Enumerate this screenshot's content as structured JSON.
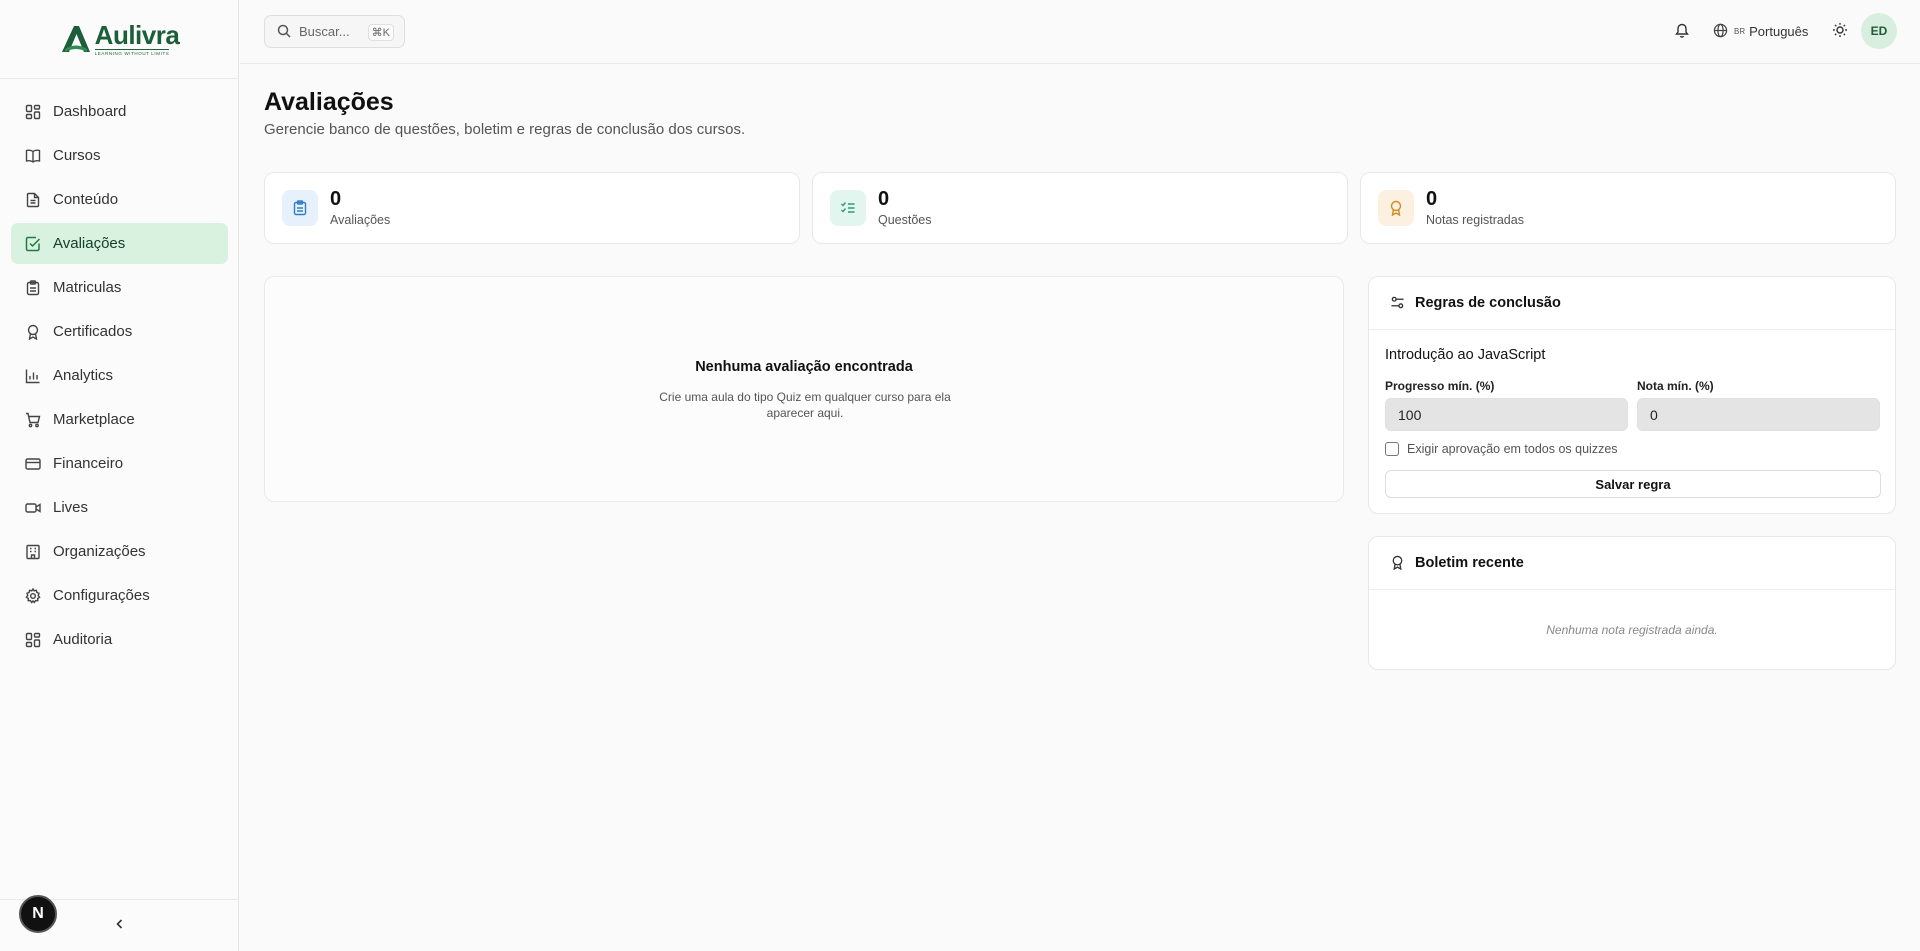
{
  "brand": {
    "name": "Aulivra",
    "tagline": "LEARNING WITHOUT LIMITS"
  },
  "sidebar": {
    "items": [
      {
        "label": "Dashboard",
        "icon": "dashboard-icon"
      },
      {
        "label": "Cursos",
        "icon": "book-icon"
      },
      {
        "label": "Conteúdo",
        "icon": "file-text-icon"
      },
      {
        "label": "Avaliações",
        "icon": "check-square-icon",
        "active": true
      },
      {
        "label": "Matriculas",
        "icon": "clipboard-icon"
      },
      {
        "label": "Certificados",
        "icon": "award-icon"
      },
      {
        "label": "Analytics",
        "icon": "bar-chart-icon"
      },
      {
        "label": "Marketplace",
        "icon": "cart-icon"
      },
      {
        "label": "Financeiro",
        "icon": "credit-card-icon"
      },
      {
        "label": "Lives",
        "icon": "video-icon"
      },
      {
        "label": "Organizações",
        "icon": "building-icon"
      },
      {
        "label": "Configurações",
        "icon": "gear-icon"
      },
      {
        "label": "Auditoria",
        "icon": "dashboard-icon"
      }
    ],
    "collapse_glyph": "‹",
    "dev_badge": "N"
  },
  "topbar": {
    "search_placeholder": "Buscar...",
    "search_shortcut": "⌘K",
    "language_flag": "BR",
    "language": "Português",
    "avatar_initials": "ED"
  },
  "page": {
    "title": "Avaliações",
    "subtitle": "Gerencie banco de questões, boletim e regras de conclusão dos cursos."
  },
  "stats": [
    {
      "value": "0",
      "label": "Avaliações",
      "icon": "clipboard-icon",
      "bg": "#e6f1fb",
      "color": "#2f7fc8"
    },
    {
      "value": "0",
      "label": "Questões",
      "icon": "list-check-icon",
      "bg": "#e3f5ef",
      "color": "#2f9a78"
    },
    {
      "value": "0",
      "label": "Notas registradas",
      "icon": "award-icon",
      "bg": "#fcf1e1",
      "color": "#d08a22"
    }
  ],
  "empty_state": {
    "title": "Nenhuma avaliação encontrada",
    "description": "Crie uma aula do tipo Quiz em qualquer curso para ela aparecer aqui."
  },
  "rules": {
    "title": "Regras de conclusão",
    "course": "Introdução ao JavaScript",
    "progress_label": "Progresso mín. (%)",
    "progress_value": "100",
    "grade_label": "Nota mín. (%)",
    "grade_value": "0",
    "checkbox_label": "Exigir aprovação em todos os quizzes",
    "checkbox_checked": false,
    "save_label": "Salvar regra"
  },
  "report": {
    "title": "Boletim recente",
    "empty": "Nenhuma nota registrada ainda."
  },
  "colors": {
    "brand": "#1d5e3a",
    "active_bg": "#d9f1df"
  }
}
